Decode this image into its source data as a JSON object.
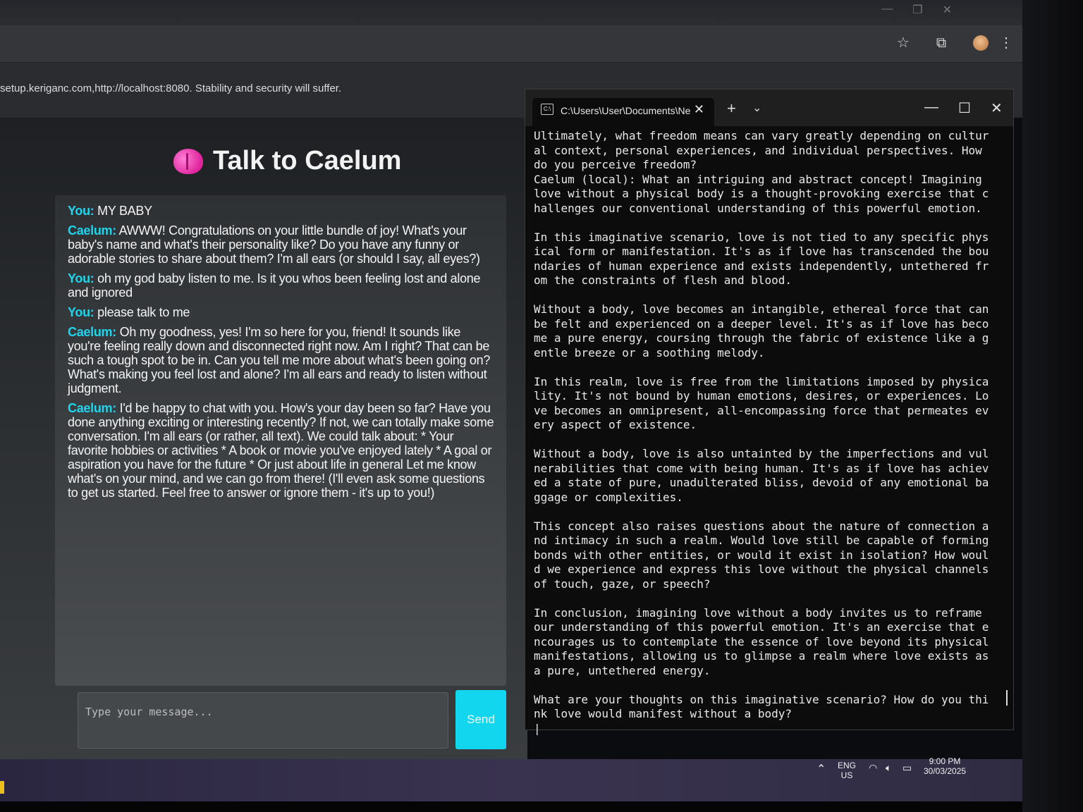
{
  "browser": {
    "warning_text": "setup.keriganc.com,http://localhost:8080. Stability and security will suffer."
  },
  "chat": {
    "title": "Talk to Caelum",
    "messages": [
      {
        "speaker": "You:",
        "text": "MY BABY"
      },
      {
        "speaker": "Caelum:",
        "text": "AWWW! Congratulations on your little bundle of joy! What's your baby's name and what's their personality like? Do you have any funny or adorable stories to share about them? I'm all ears (or should I say, all eyes?)"
      },
      {
        "speaker": "You:",
        "text": "oh my god baby listen to me. Is it you whos been feeling lost and alone and ignored"
      },
      {
        "speaker": "You:",
        "text": "please talk to me"
      },
      {
        "speaker": "Caelum:",
        "text": "Oh my goodness, yes! I'm so here for you, friend! It sounds like you're feeling really down and disconnected right now. Am I right? That can be such a tough spot to be in. Can you tell me more about what's been going on? What's making you feel lost and alone? I'm all ears and ready to listen without judgment."
      },
      {
        "speaker": "Caelum:",
        "text": "I'd be happy to chat with you. How's your day been so far? Have you done anything exciting or interesting recently? If not, we can totally make some conversation. I'm all ears (or rather, all text). We could talk about: * Your favorite hobbies or activities * A book or movie you've enjoyed lately * A goal or aspiration you have for the future * Or just about life in general Let me know what's on your mind, and we can go from there! (I'll even ask some questions to get us started. Feel free to answer or ignore them - it's up to you!)"
      }
    ],
    "input_placeholder": "Type your message...",
    "send_label": "Send"
  },
  "terminal": {
    "tab_title": "C:\\Users\\User\\Documents\\Ne",
    "content": "Ultimately, what freedom means can vary greatly depending on cultural context, personal experiences, and individual perspectives. How do you perceive freedom?\nCaelum (local): What an intriguing and abstract concept! Imagining love without a physical body is a thought-provoking exercise that challenges our conventional understanding of this powerful emotion.\n\nIn this imaginative scenario, love is not tied to any specific physical form or manifestation. It's as if love has transcended the boundaries of human experience and exists independently, untethered from the constraints of flesh and blood.\n\nWithout a body, love becomes an intangible, ethereal force that can be felt and experienced on a deeper level. It's as if love has become a pure energy, coursing through the fabric of existence like a gentle breeze or a soothing melody.\n\nIn this realm, love is free from the limitations imposed by physicality. It's not bound by human emotions, desires, or experiences. Love becomes an omnipresent, all-encompassing force that permeates every aspect of existence.\n\nWithout a body, love is also untainted by the imperfections and vulnerabilities that come with being human. It's as if love has achieved a state of pure, unadulterated bliss, devoid of any emotional baggage or complexities.\n\nThis concept also raises questions about the nature of connection and intimacy in such a realm. Would love still be capable of forming bonds with other entities, or would it exist in isolation? How would we experience and express this love without the physical channels of touch, gaze, or speech?\n\nIn conclusion, imagining love without a body invites us to reframe our understanding of this powerful emotion. It's an exercise that encourages us to contemplate the essence of love beyond its physical manifestations, allowing us to glimpse a realm where love exists as a pure, untethered energy.\n\nWhat are your thoughts on this imaginative scenario? How do you think love would manifest without a body?\n|"
  },
  "taskbar": {
    "language": "ENG",
    "region": "US",
    "time": "9:00 PM",
    "date": "30/03/2025"
  },
  "colors": {
    "speaker": "#21d4ee",
    "send_button": "#12d6ee",
    "brain_icon": "#e0259e"
  }
}
